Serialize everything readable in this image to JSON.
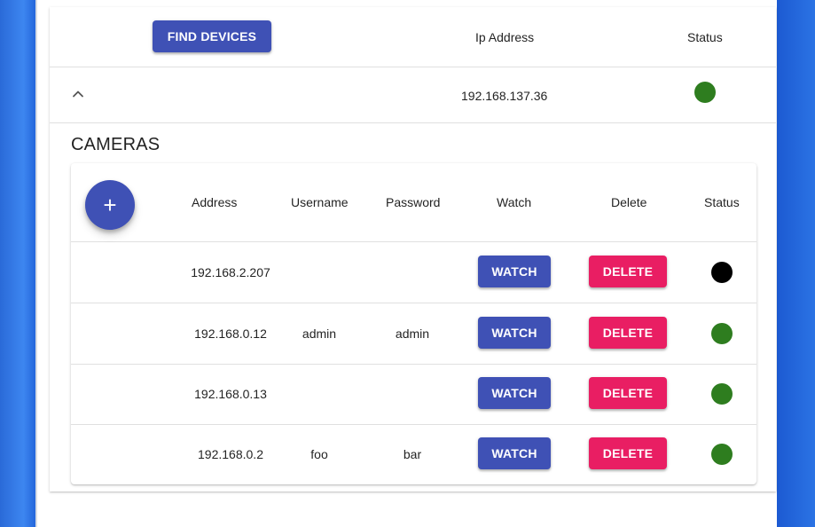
{
  "header": {
    "find_devices_label": "FIND DEVICES",
    "ip_address_label": "Ip Address",
    "status_label": "Status"
  },
  "device": {
    "ip": "192.168.137.36",
    "status_color": "#2e7d1f",
    "expand_icon": "chevron-up-icon"
  },
  "cameras": {
    "title": "CAMERAS",
    "add_icon": "plus-icon",
    "add_label": "+",
    "columns": {
      "address": "Address",
      "username": "Username",
      "password": "Password",
      "watch": "Watch",
      "delete": "Delete",
      "status": "Status"
    },
    "watch_label": "WATCH",
    "delete_label": "DELETE",
    "rows": [
      {
        "address": "192.168.2.207",
        "username": "",
        "password": "",
        "status_color": "#000000"
      },
      {
        "address": "192.168.0.12",
        "username": "admin",
        "password": "admin",
        "status_color": "#2e7d1f"
      },
      {
        "address": "192.168.0.13",
        "username": "",
        "password": "",
        "status_color": "#2e7d1f"
      },
      {
        "address": "192.168.0.2",
        "username": "foo",
        "password": "bar",
        "status_color": "#2e7d1f"
      }
    ]
  },
  "colors": {
    "primary": "#3f51b5",
    "secondary": "#e91e63",
    "status_online": "#2e7d1f",
    "status_offline": "#000000"
  }
}
